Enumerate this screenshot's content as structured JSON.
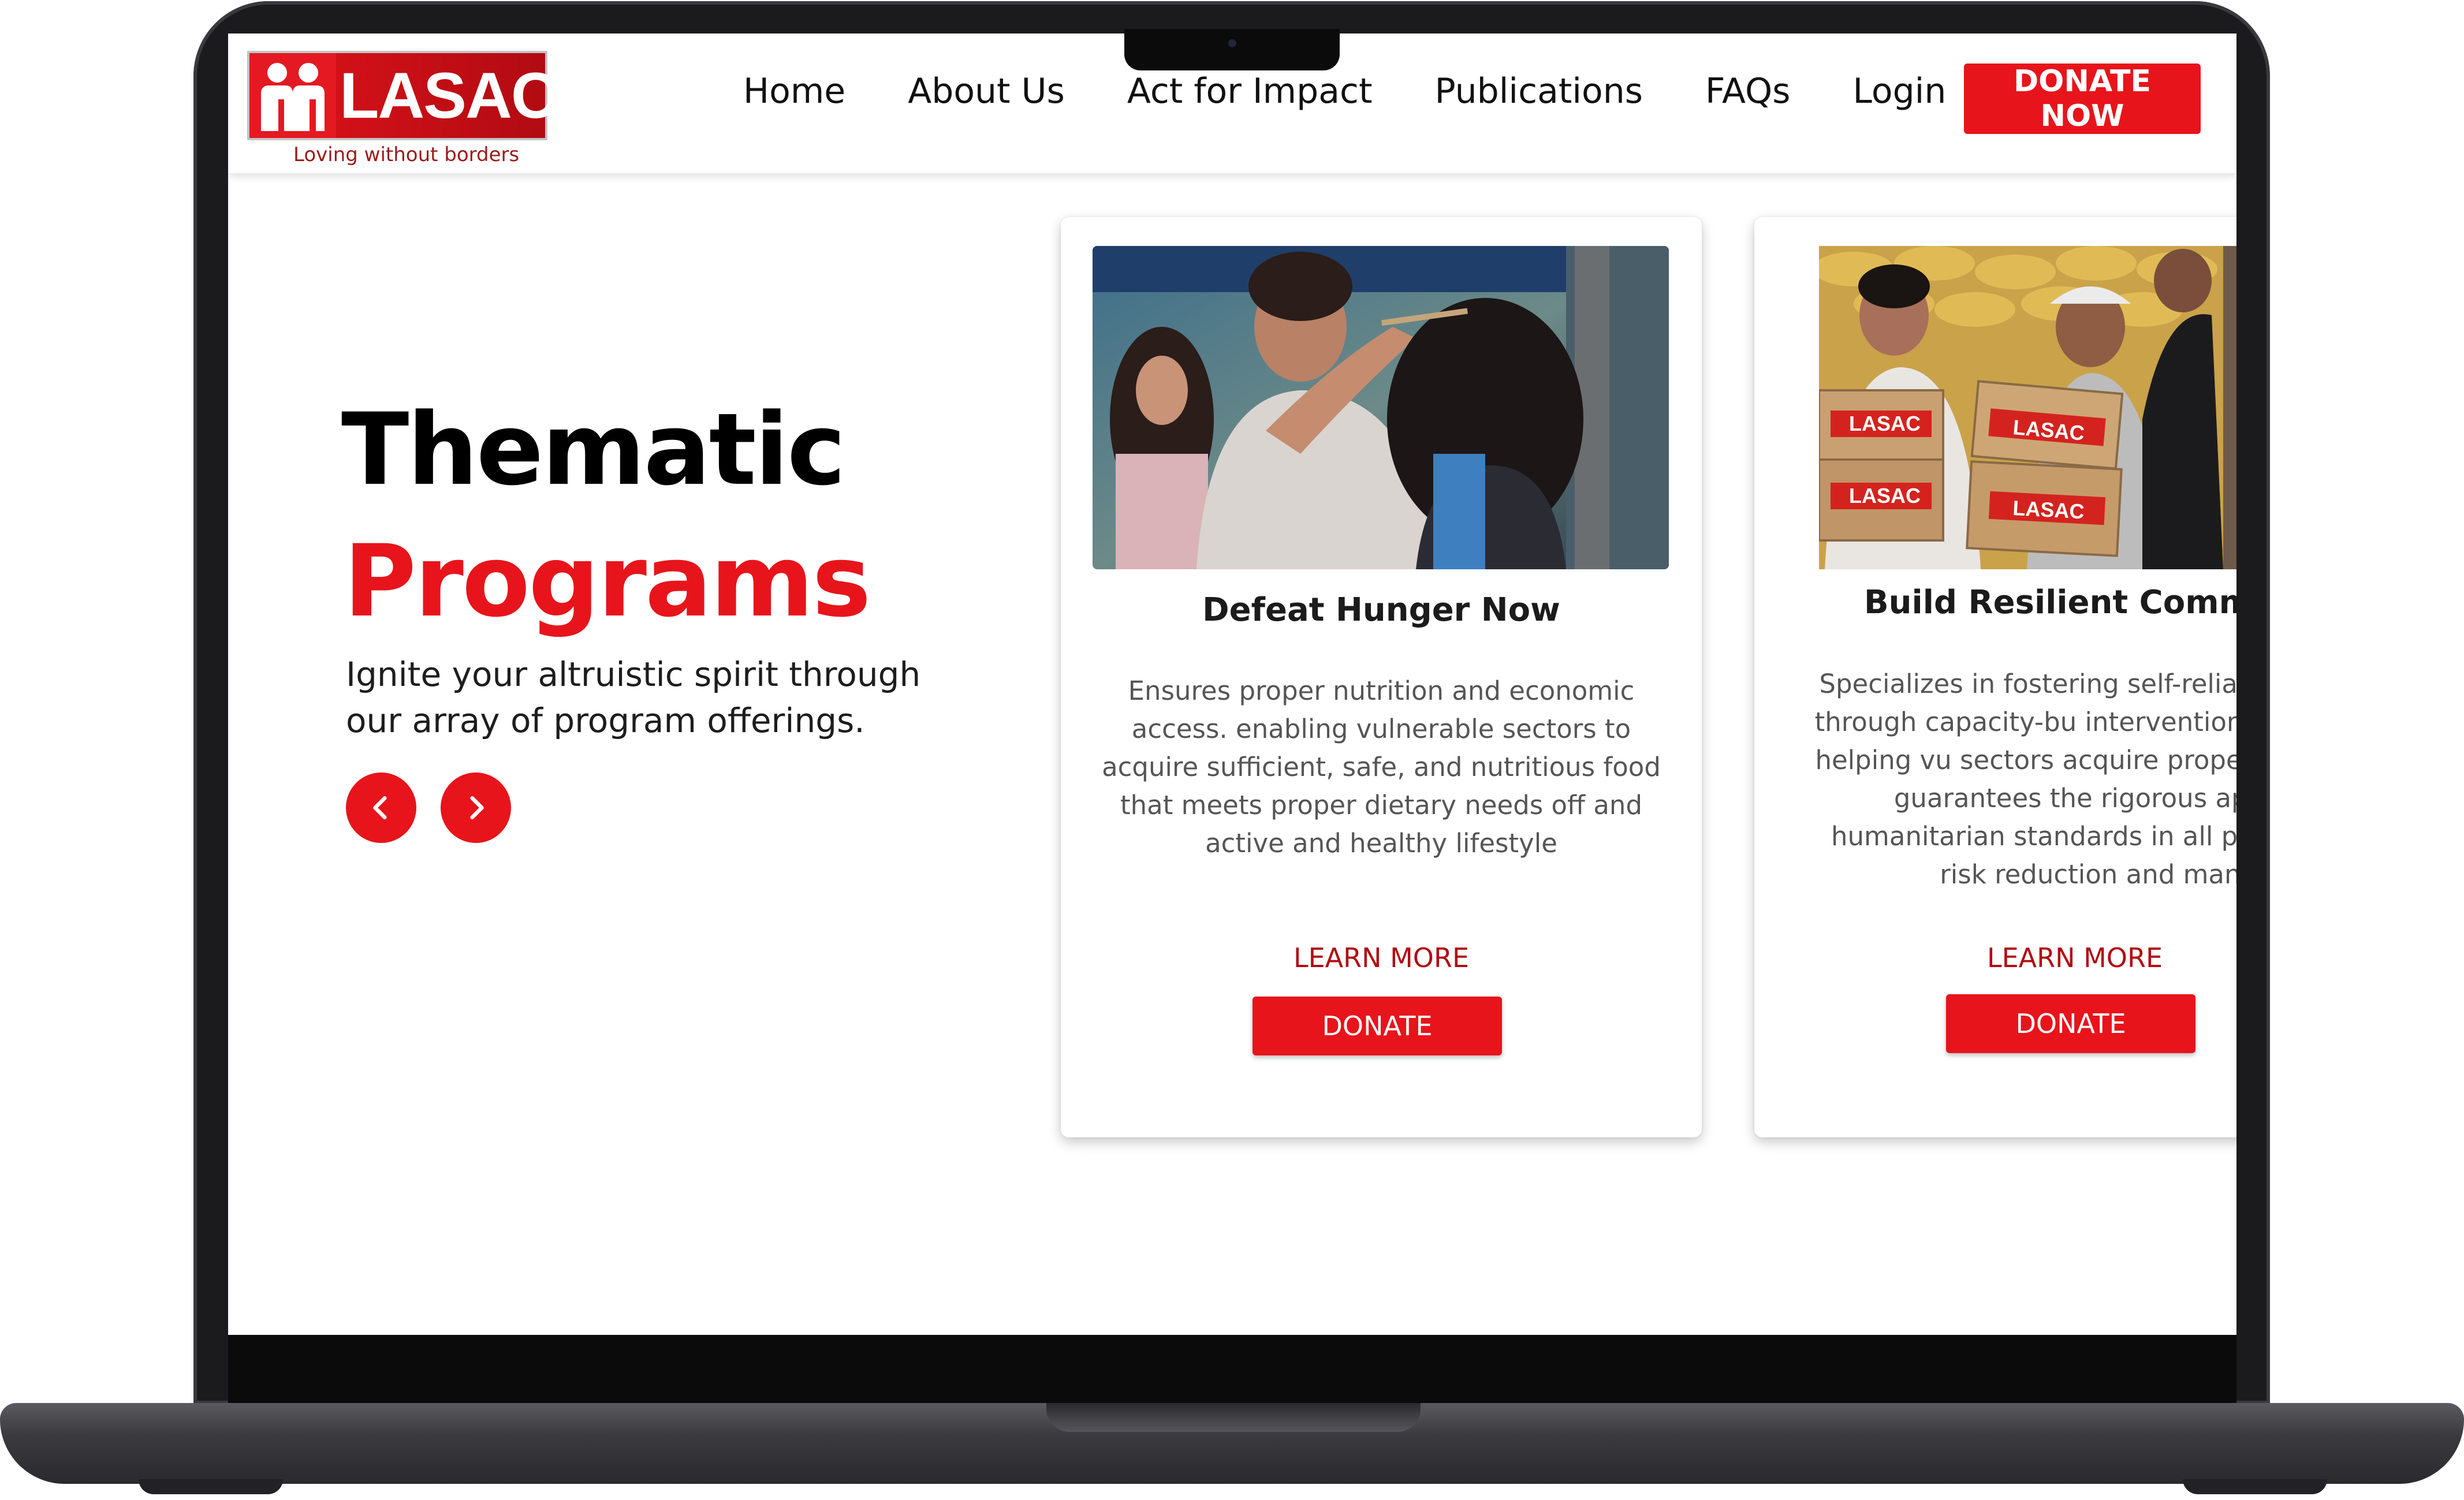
{
  "brand": {
    "name": "LASAC",
    "tagline": "Loving without borders"
  },
  "nav": {
    "items": [
      "Home",
      "About Us",
      "Act for Impact",
      "Publications",
      "FAQs",
      "Login"
    ],
    "donate_label": "DONATE NOW"
  },
  "hero": {
    "title_line1": "Thematic",
    "title_line2": "Programs",
    "subtitle": "Ignite your altruistic spirit through our array of program offerings.",
    "prev_icon": "chevron-left-icon",
    "next_icon": "chevron-right-icon"
  },
  "cards": [
    {
      "title": "Defeat Hunger Now",
      "description": "Ensures proper nutrition and economic access. enabling vulnerable sectors to acquire sufficient, safe, and nutritious food that meets proper dietary needs off and active and healthy lifestyle",
      "learn_more": "LEARN MORE",
      "donate": "DONATE"
    },
    {
      "title": "Build Resilient Communi",
      "description": "Specializes in fostering self-relian autonomy through capacity-bu interventions, alongside helping vu sectors acquire proper housing. It guarantees the rigorous applicat humanitarian standards in all pha disaster risk reduction and manag",
      "box_label": "LASAC",
      "learn_more": "LEARN MORE",
      "donate": "DONATE"
    }
  ],
  "colors": {
    "accent": "#e8141b",
    "dark_red": "#b10b12",
    "text": "#111111"
  }
}
